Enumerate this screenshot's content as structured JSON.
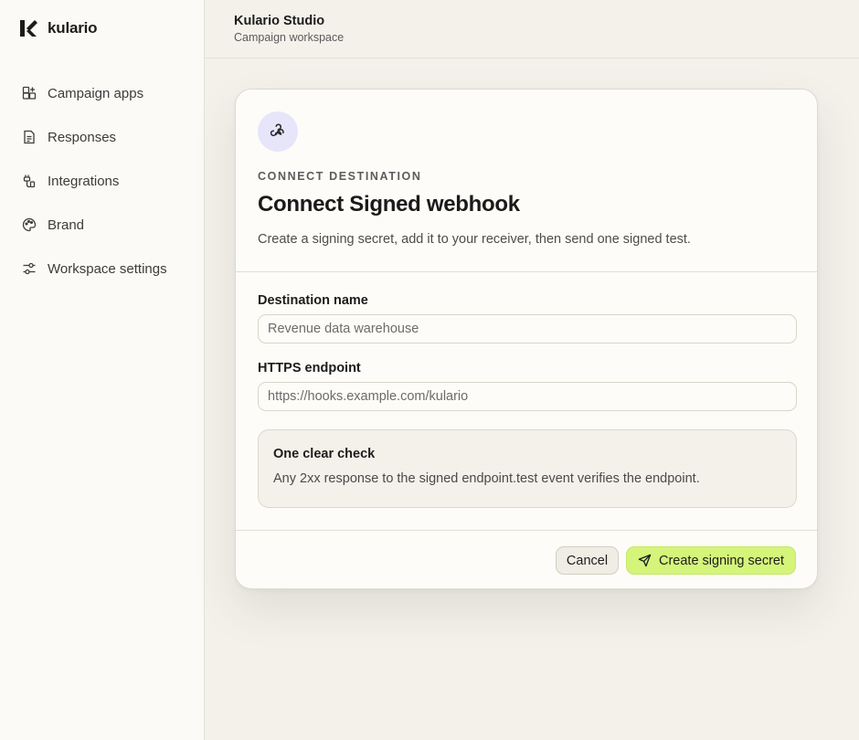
{
  "app": {
    "brand_name": "kulario"
  },
  "sidebar": {
    "items": [
      {
        "label": "Campaign apps",
        "icon": "grid-plus-icon"
      },
      {
        "label": "Responses",
        "icon": "document-icon"
      },
      {
        "label": "Integrations",
        "icon": "plug-icon"
      },
      {
        "label": "Brand",
        "icon": "palette-icon"
      },
      {
        "label": "Workspace settings",
        "icon": "sliders-icon"
      }
    ]
  },
  "header": {
    "title": "Kulario Studio",
    "subtitle": "Campaign workspace"
  },
  "dialog": {
    "icon": "webhook-icon",
    "eyebrow": "CONNECT DESTINATION",
    "title": "Connect Signed webhook",
    "description": "Create a signing secret, add it to your receiver, then send one signed test.",
    "fields": {
      "name": {
        "label": "Destination name",
        "placeholder": "Revenue data warehouse",
        "value": ""
      },
      "endpoint": {
        "label": "HTTPS endpoint",
        "placeholder": "https://hooks.example.com/kulario",
        "value": ""
      }
    },
    "check": {
      "title": "One clear check",
      "text": "Any 2xx response to the signed endpoint.test event verifies the endpoint."
    },
    "actions": {
      "cancel_label": "Cancel",
      "primary_label": "Create signing secret",
      "primary_icon": "send-icon"
    }
  },
  "colors": {
    "accent": "#d4f57a",
    "icon_badge": "#e6e5fa",
    "background": "#f3f1ea",
    "sidebar": "#fbfaf6"
  }
}
